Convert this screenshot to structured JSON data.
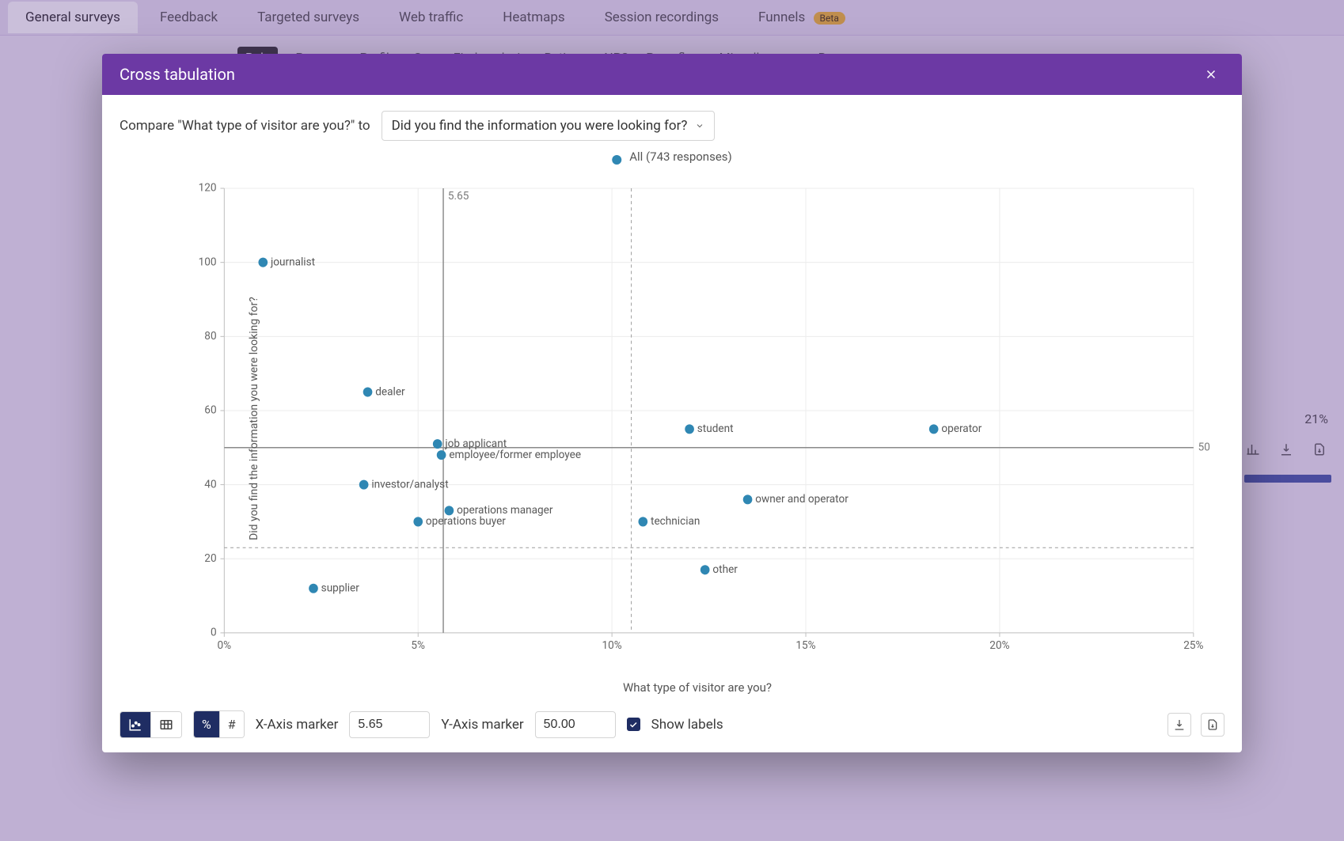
{
  "nav": {
    "tabs": [
      {
        "label": "General surveys",
        "active": true
      },
      {
        "label": "Feedback"
      },
      {
        "label": "Targeted surveys"
      },
      {
        "label": "Web traffic"
      },
      {
        "label": "Heatmaps"
      },
      {
        "label": "Session recordings"
      },
      {
        "label": "Funnels",
        "badge": "Beta"
      }
    ],
    "subtabs": [
      "Role",
      "Purpose",
      "Profile",
      "Geo",
      "Find analysis",
      "Ratings",
      "NPS",
      "Page flow",
      "Miscellaneous",
      "Responses"
    ]
  },
  "bg_right": {
    "pct": "21%"
  },
  "modal": {
    "title": "Cross tabulation",
    "compare_prefix": "Compare \"What type of visitor are you?\" to",
    "compare_select": "Did you find the information you were looking for?"
  },
  "toolbar": {
    "x_marker_label": "X-Axis marker",
    "x_marker_value": "5.65",
    "y_marker_label": "Y-Axis marker",
    "y_marker_value": "50.00",
    "show_labels_label": "Show labels"
  },
  "chart_data": {
    "type": "scatter",
    "title": "",
    "all_label": "All (743 responses)",
    "xlabel": "What type of visitor are you?",
    "ylabel": "Did you find the information you were looking for?",
    "xlim": [
      0,
      25
    ],
    "ylim": [
      0,
      120
    ],
    "x_ticks": [
      0,
      5,
      10,
      15,
      20,
      25
    ],
    "x_tick_labels": [
      "0%",
      "5%",
      "10%",
      "15%",
      "20%",
      "25%"
    ],
    "y_ticks": [
      0,
      20,
      40,
      60,
      80,
      100,
      120
    ],
    "guides": {
      "x_solid": 5.65,
      "x_solid_label": "5.65",
      "x_dashed": 10.5,
      "y_solid": 50,
      "y_solid_label": "50",
      "y_dashed": 23
    },
    "points": [
      {
        "label": "journalist",
        "x": 1.0,
        "y": 100
      },
      {
        "label": "dealer",
        "x": 3.7,
        "y": 65
      },
      {
        "label": "job applicant",
        "x": 5.5,
        "y": 51
      },
      {
        "label": "employee/former employee",
        "x": 5.6,
        "y": 48
      },
      {
        "label": "investor/analyst",
        "x": 3.6,
        "y": 40
      },
      {
        "label": "operations manager",
        "x": 5.8,
        "y": 33
      },
      {
        "label": "operations buyer",
        "x": 5.0,
        "y": 30
      },
      {
        "label": "student",
        "x": 12.0,
        "y": 55
      },
      {
        "label": "operator",
        "x": 18.3,
        "y": 55
      },
      {
        "label": "owner and operator",
        "x": 13.5,
        "y": 36
      },
      {
        "label": "technician",
        "x": 10.8,
        "y": 30
      },
      {
        "label": "other",
        "x": 12.4,
        "y": 17
      },
      {
        "label": "supplier",
        "x": 2.3,
        "y": 12
      }
    ]
  }
}
